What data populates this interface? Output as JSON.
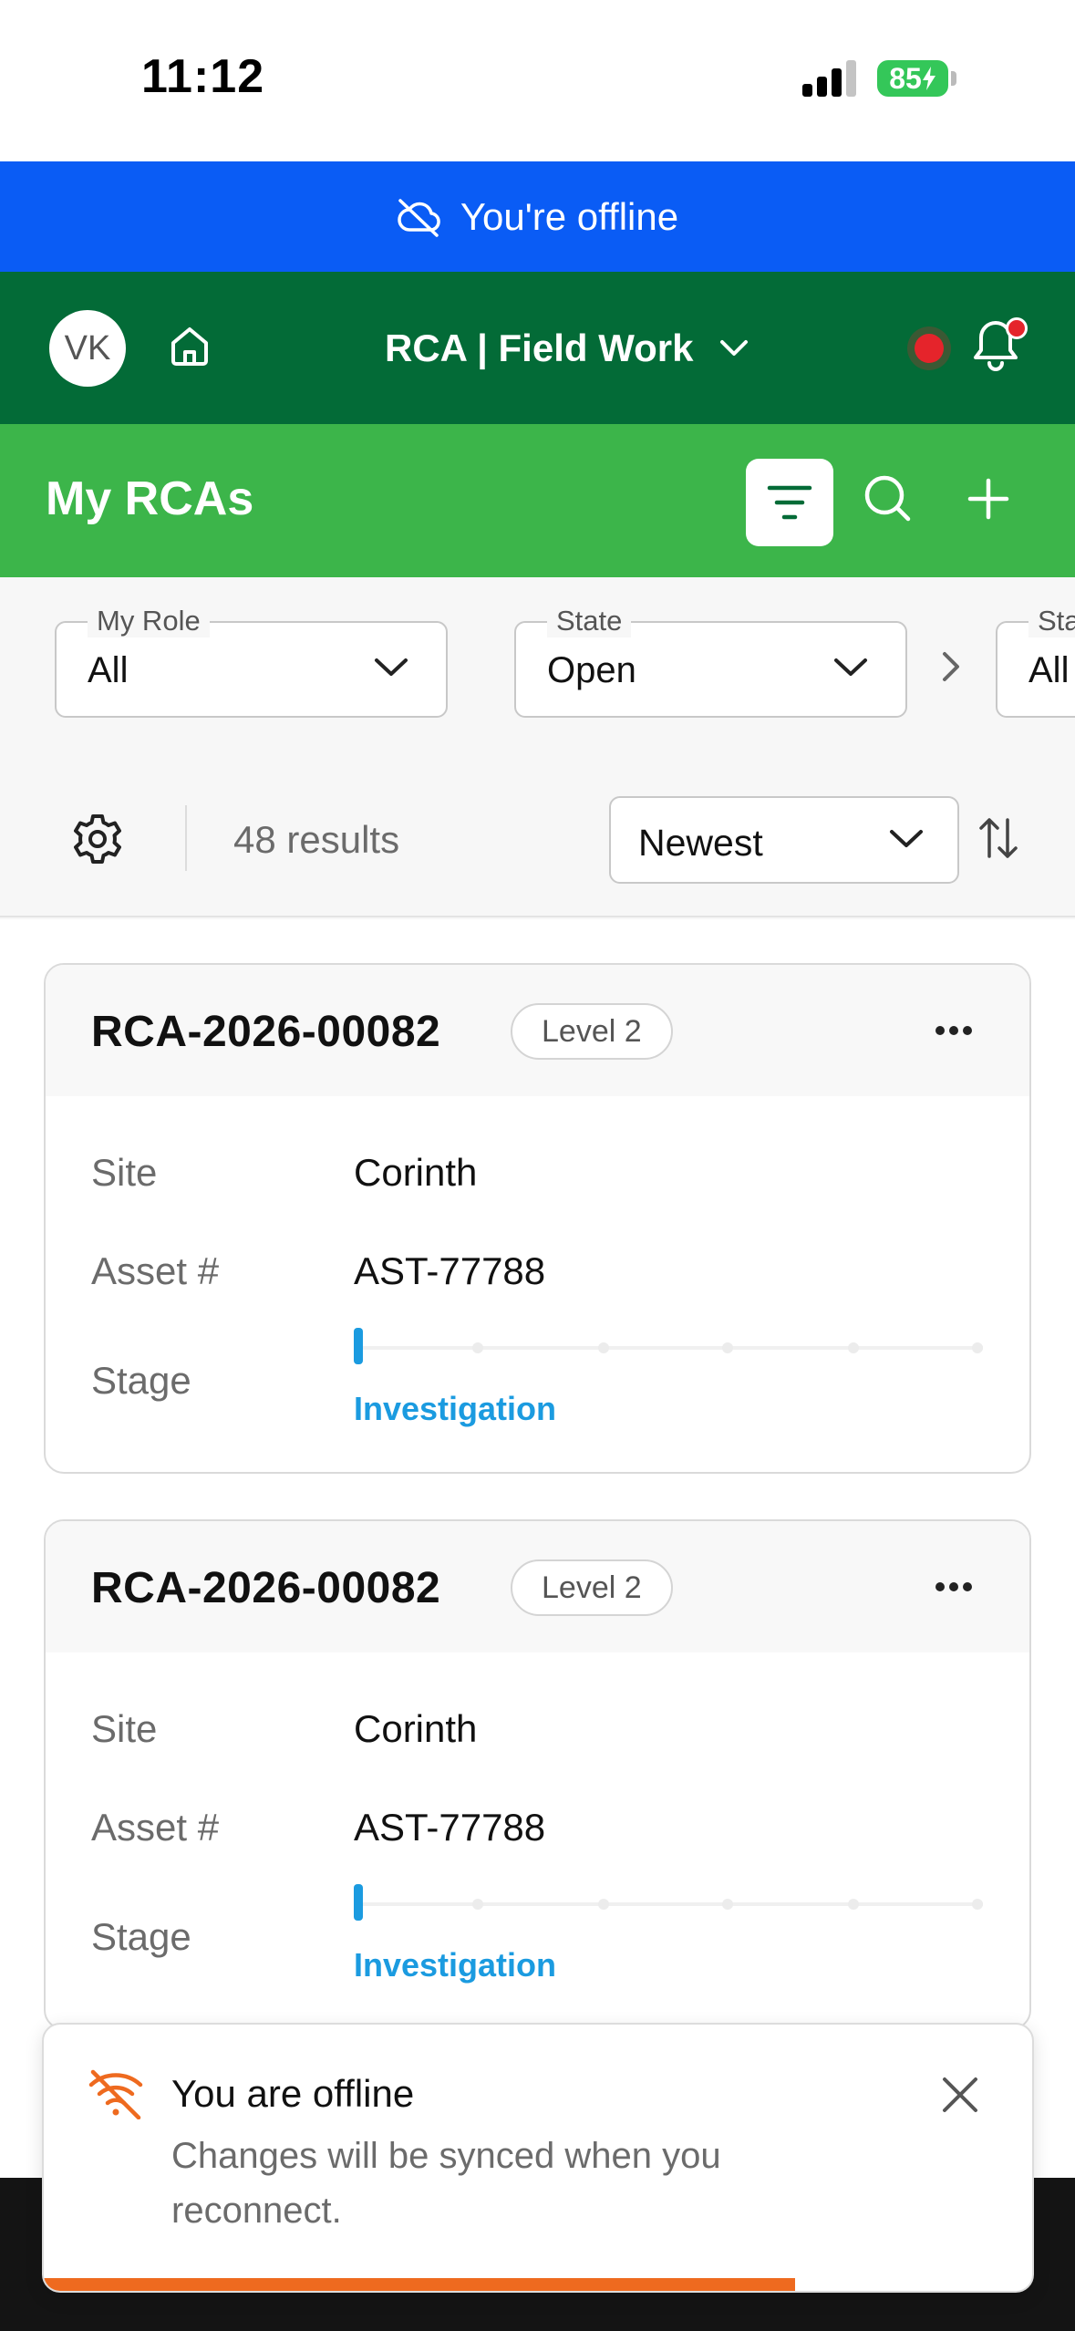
{
  "status_bar": {
    "time": "11:12",
    "battery": "85"
  },
  "offline_banner": {
    "text": "You're offline"
  },
  "header": {
    "avatar_initials": "VK",
    "workspace": "RCA | Field Work"
  },
  "title_bar": {
    "title": "My RCAs"
  },
  "filters": [
    {
      "label": "My Role",
      "value": "All"
    },
    {
      "label": "State",
      "value": "Open"
    },
    {
      "label": "Sta",
      "value": "All"
    }
  ],
  "results": {
    "count_text": "48 results",
    "sort": "Newest"
  },
  "cards": [
    {
      "id": "RCA-2026-00082",
      "level": "Level 2",
      "fields": [
        {
          "key": "Site",
          "value": "Corinth"
        },
        {
          "key": "Asset #",
          "value": "AST-77788"
        }
      ],
      "stage_key": "Stage",
      "stage": "Investigation"
    },
    {
      "id": "RCA-2026-00082",
      "level": "Level 2",
      "fields": [
        {
          "key": "Site",
          "value": "Corinth"
        },
        {
          "key": "Asset #",
          "value": "AST-77788"
        }
      ],
      "stage_key": "Stage",
      "stage": "Investigation"
    }
  ],
  "toast": {
    "title": "You are offline",
    "message": "Changes will be synced when you reconnect.",
    "progress_fraction": 0.76
  },
  "colors": {
    "offline_blue": "#0a5cf5",
    "header_green": "#036b37",
    "title_green": "#3cb54a",
    "stage_blue": "#1b9be0",
    "warning_orange": "#ee6a1f"
  }
}
